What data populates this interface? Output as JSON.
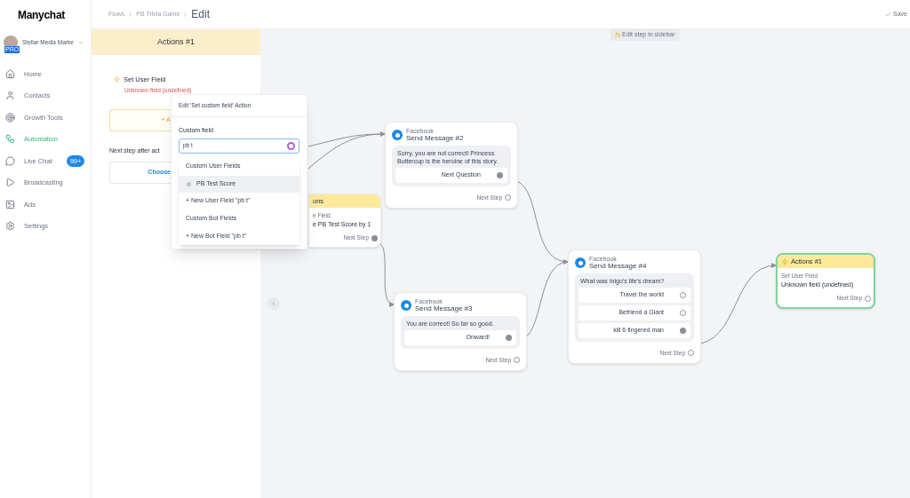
{
  "sidebar": {
    "logo": "Manychat",
    "account": {
      "name": "Stellar Media Marke",
      "badge": "PRO"
    },
    "items": [
      {
        "label": "Home",
        "selected": false
      },
      {
        "label": "Contacts",
        "selected": false
      },
      {
        "label": "Growth Tools",
        "selected": false
      },
      {
        "label": "Automation",
        "selected": true
      },
      {
        "label": "Live Chat",
        "selected": false,
        "badge": "99+"
      },
      {
        "label": "Broadcasting",
        "selected": false
      },
      {
        "label": "Ads",
        "selected": false
      },
      {
        "label": "Settings",
        "selected": false
      }
    ]
  },
  "breadcrumb": [
    "Flows",
    "PB Trivia Game",
    "Edit"
  ],
  "save": "Save",
  "panel": {
    "title": "Actions #1",
    "action_title": "Set User Field",
    "action_error": "Unknown field (undefined)",
    "add_button": "+ A",
    "next_label": "Next step after act",
    "choose_button": "Choose"
  },
  "popup": {
    "title": "Edit 'Set custom field' Action",
    "field_label": "Custom field",
    "value": "pb t",
    "options": [
      {
        "kind": "header",
        "label": "Custom User Fields"
      },
      {
        "kind": "field",
        "label": "PB Test Score",
        "selected": true
      },
      {
        "kind": "new",
        "label": "+ New User Field \"pb t\"",
        "selected": false
      },
      {
        "kind": "header",
        "label": "Custom Bot Fields"
      },
      {
        "kind": "new",
        "label": "+ New Bot Field \"pb t\"",
        "selected": false
      }
    ]
  },
  "canvas": {
    "hint": "Edit step in sidebar",
    "nodes": [
      {
        "kind": "action",
        "title": "ons",
        "field_label": "e Field",
        "field_value": "e PB Test Score by 1",
        "selected": false,
        "next": {
          "label": "Next Step",
          "connected": true
        }
      },
      {
        "kind": "message",
        "source": "Facebook",
        "title": "Send Message #2",
        "text": "Sorry, you are not correct! Princess Buttercup is the heroine of this story.",
        "buttons": [
          {
            "label": "Next Question",
            "connected": true
          }
        ],
        "next": {
          "label": "Next Step",
          "connected": false
        }
      },
      {
        "kind": "message",
        "source": "Facebook",
        "title": "Send Message #3",
        "text": "You are correct! So far so good.",
        "buttons": [
          {
            "label": "Onward!",
            "connected": true
          }
        ],
        "next": {
          "label": "Next Step",
          "connected": false
        }
      },
      {
        "kind": "message",
        "source": "Facebook",
        "title": "Send Message #4",
        "text": "What was Inigo's life's dream?",
        "buttons": [
          {
            "label": "Travel the world",
            "connected": false
          },
          {
            "label": "Befriend a Giant",
            "connected": false
          },
          {
            "label": "kill 6 fingered man",
            "connected": true
          }
        ],
        "next": {
          "label": "Next Step",
          "connected": false
        }
      },
      {
        "kind": "action",
        "title": "Actions #1",
        "field_label": "Set User Field",
        "field_value": "Unknown field (undefined)",
        "selected": true,
        "next": {
          "label": "Next Step",
          "connected": false
        }
      }
    ]
  }
}
